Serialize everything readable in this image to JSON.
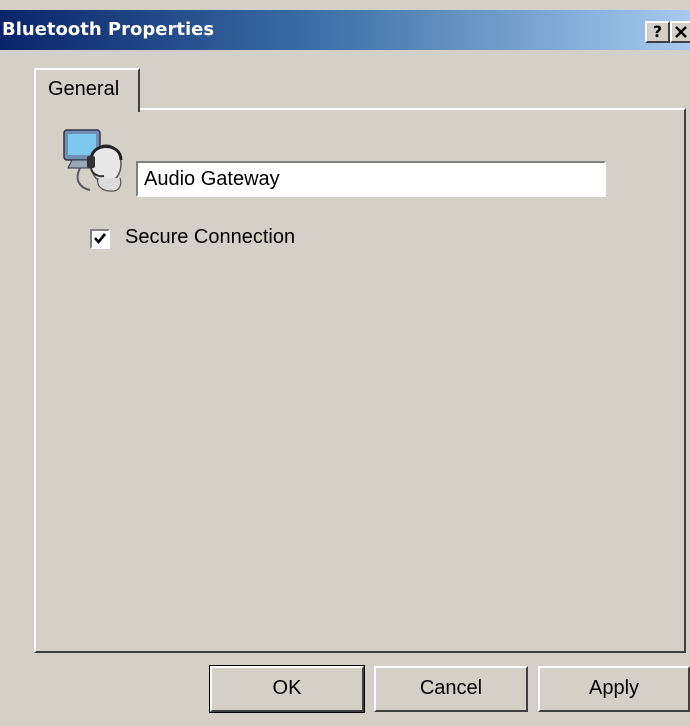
{
  "window": {
    "title": "Bluetooth Properties",
    "help_button": "?",
    "close_button": "✕"
  },
  "tabs": [
    {
      "label": "General",
      "selected": true
    }
  ],
  "general": {
    "device_icon": "headset-computer-icon",
    "device_name": "Audio Gateway",
    "secure_connection_label": "Secure Connection",
    "secure_connection_checked": true
  },
  "buttons": {
    "ok": "OK",
    "cancel": "Cancel",
    "apply": "Apply"
  }
}
